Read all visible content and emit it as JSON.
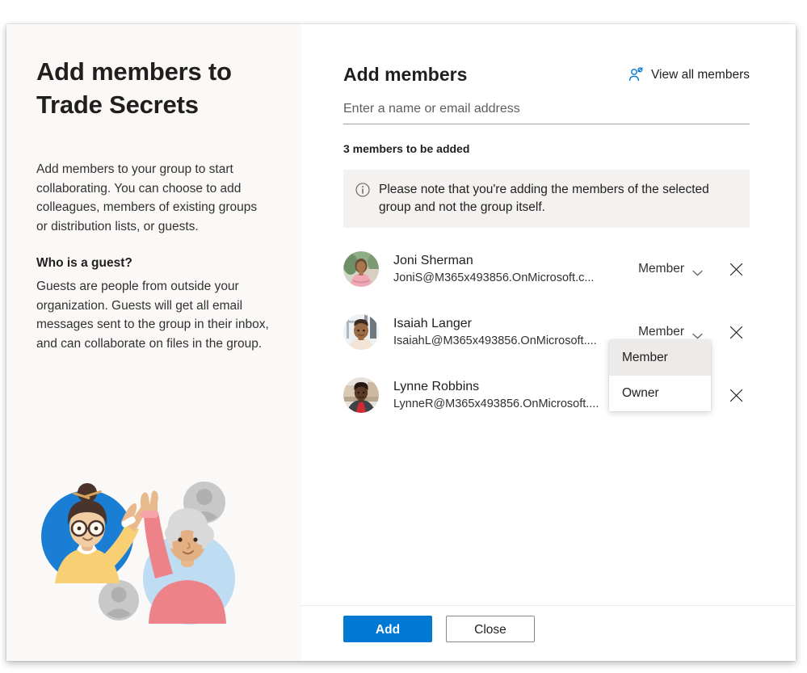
{
  "left_panel": {
    "title": "Add members to Trade Secrets",
    "paragraph": "Add members to your group to start collaborating. You can choose to add colleagues, members of existing groups or distribution lists, or guests.",
    "subheading": "Who is a guest?",
    "guest_paragraph": "Guests are people from outside your organization. Guests will get all email messages sent to the group in their inbox, and can collaborate on files in the group.",
    "illustration_name": "two-people-high-five-illustration"
  },
  "main": {
    "heading": "Add members",
    "view_all": {
      "label": "View all members",
      "icon": "person-add-icon"
    },
    "search": {
      "value": "",
      "placeholder": "Enter a name or email address"
    },
    "count_label": "3 members to be added",
    "info_banner": {
      "icon": "info-icon",
      "text": "Please note that you're adding the members of the selected group and not the group itself."
    },
    "members": [
      {
        "name": "Joni Sherman",
        "email": "JoniS@M365x493856.OnMicrosoft.c...",
        "role": "Member",
        "avatar": "joni-sherman-avatar",
        "remove_icon": "close-icon"
      },
      {
        "name": "Isaiah Langer",
        "email": "IsaiahL@M365x493856.OnMicrosoft....",
        "role": "Member",
        "avatar": "isaiah-langer-avatar",
        "remove_icon": "close-icon"
      },
      {
        "name": "Lynne Robbins",
        "email": "LynneR@M365x493856.OnMicrosoft....",
        "role": "Member",
        "avatar": "lynne-robbins-avatar",
        "remove_icon": "close-icon"
      }
    ],
    "role_dropdown": {
      "open": true,
      "owner_row_index": 1,
      "options": [
        {
          "label": "Member",
          "selected": true
        },
        {
          "label": "Owner",
          "selected": false
        }
      ]
    }
  },
  "footer": {
    "add_label": "Add",
    "close_label": "Close"
  },
  "colors": {
    "accent": "#0078d4",
    "panel_bg": "#faf9f8",
    "banner_bg": "#f3f2f1",
    "highlight": "#edebe9",
    "text": "#201f1e",
    "text_secondary": "#323130",
    "divider": "#a19f9d"
  }
}
